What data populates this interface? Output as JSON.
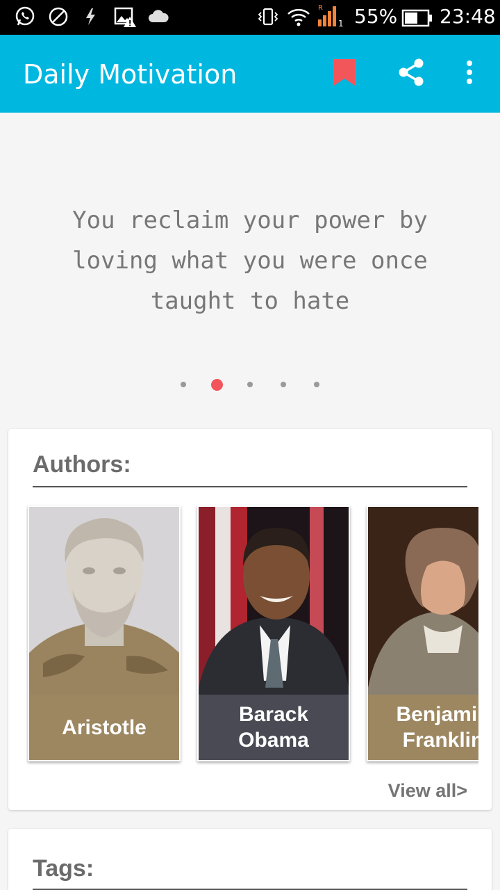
{
  "status_bar": {
    "battery_percent": "55%",
    "time": "23:48",
    "roaming_indicator": "R",
    "sim_slot": "1",
    "icons": [
      "whatsapp-icon",
      "blocked-icon",
      "flash-icon",
      "image-warning-icon",
      "cloud-icon",
      "vibrate-icon",
      "wifi-icon",
      "signal-icon",
      "battery-icon"
    ]
  },
  "app_bar": {
    "title": "Daily Motivation",
    "icons": [
      "bookmark-icon",
      "share-icon",
      "overflow-menu-icon"
    ],
    "bookmark_color": "#f2555a",
    "background_color": "#00b7e0"
  },
  "quote": {
    "text": "You reclaim your power by loving what you were once taught to hate",
    "page_count": 5,
    "active_page": 2
  },
  "authors_section": {
    "heading": "Authors:",
    "view_all": "View all>",
    "authors": [
      {
        "name": "Aristotle",
        "color": "#9d8761"
      },
      {
        "name": "Barack\nObama",
        "color": "#4a4a55"
      },
      {
        "name": "Benjamin\nFranklin",
        "color": "#9d8761"
      }
    ]
  },
  "tags_section": {
    "heading": "Tags:"
  }
}
